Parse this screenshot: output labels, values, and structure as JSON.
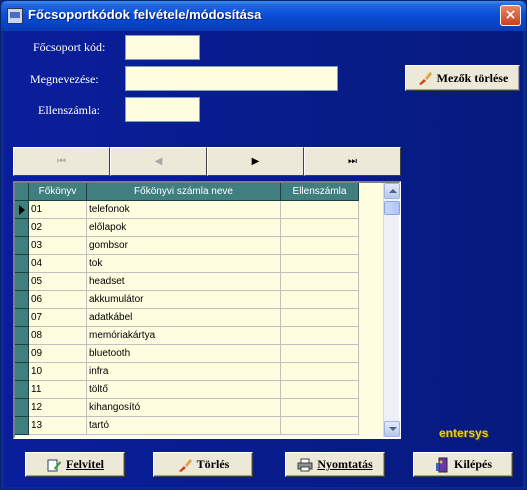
{
  "window": {
    "title": "Főcsoportkódok felvétele/módosítása",
    "close_glyph": "×"
  },
  "form": {
    "fields": [
      {
        "label": "Főcsoport kód:",
        "value": ""
      },
      {
        "label": "Megnevezése:",
        "value": ""
      },
      {
        "label": "Ellenszámla:",
        "value": ""
      }
    ],
    "clear_button": "Mezők törlése"
  },
  "navigator": {
    "first": "⏮",
    "prev": "◀",
    "next": "▶",
    "last": "⏭"
  },
  "grid": {
    "columns": [
      "Főkönyv",
      "Főkönyvi számla neve",
      "Ellenszámla"
    ],
    "rows": [
      {
        "code": "01",
        "name": "telefonok",
        "ellen": ""
      },
      {
        "code": "02",
        "name": "előlapok",
        "ellen": ""
      },
      {
        "code": "03",
        "name": "gombsor",
        "ellen": ""
      },
      {
        "code": "04",
        "name": "tok",
        "ellen": ""
      },
      {
        "code": "05",
        "name": "headset",
        "ellen": ""
      },
      {
        "code": "06",
        "name": "akkumulátor",
        "ellen": ""
      },
      {
        "code": "07",
        "name": "adatkábel",
        "ellen": ""
      },
      {
        "code": "08",
        "name": "memóriakártya",
        "ellen": ""
      },
      {
        "code": "09",
        "name": "bluetooth",
        "ellen": ""
      },
      {
        "code": "10",
        "name": "infra",
        "ellen": ""
      },
      {
        "code": "11",
        "name": "töltő",
        "ellen": ""
      },
      {
        "code": "12",
        "name": "kihangosító",
        "ellen": ""
      },
      {
        "code": "13",
        "name": "tartó",
        "ellen": ""
      }
    ]
  },
  "brand": "entersys",
  "buttons": {
    "felvitel": "Felvitel",
    "torles": "Törlés",
    "nyomtatas": "Nyomtatás",
    "kilepes": "Kilépés"
  },
  "colors": {
    "background": "#0a1e9c",
    "grid_header": "#3f7f7f",
    "grid_cell": "#fffde0",
    "brand": "#e8d020"
  }
}
